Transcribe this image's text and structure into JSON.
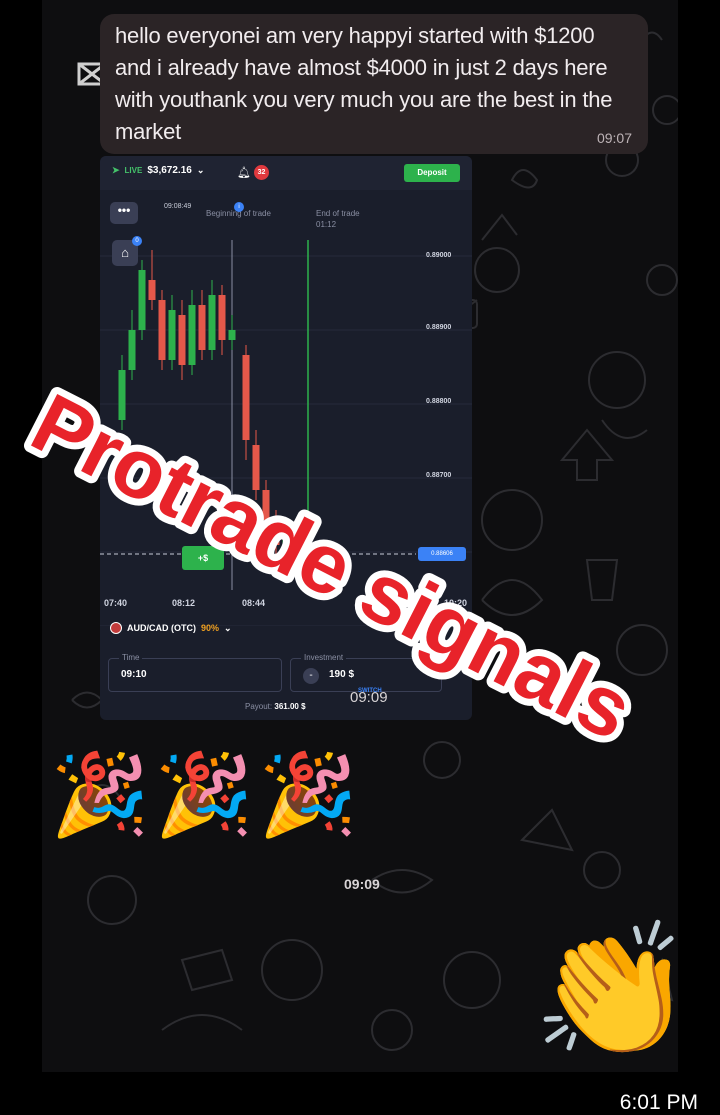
{
  "message": {
    "text": "hello everyonei am very happyi started with $1200 and i already have almost $4000 in just 2 days here with youthank you very much you are the best in the market",
    "time": "09:07"
  },
  "trading_screenshot": {
    "live_tag": "LIVE",
    "balance": "$3,672.16",
    "notifications": "32",
    "deposit_label": "Deposit",
    "menu_label": "•••",
    "home_badge": "0",
    "clock": "09:08:49",
    "beginning_label": "Beginning of trade",
    "end_label": "End of trade",
    "end_time": "01:12",
    "y_ticks": [
      "0.89000",
      "0.88900",
      "0.88800",
      "0.88700"
    ],
    "current_price": "0.88606",
    "x_ticks": [
      "07:40",
      "08:12",
      "08:44",
      "10:20"
    ],
    "trade_chip": "+$",
    "pair": "AUD/CAD (OTC)",
    "pair_percent": "90%",
    "time_label": "Time",
    "time_value": "09:10",
    "investment_label": "Investment",
    "investment_value": "190 $",
    "switch_label": "SWITCH",
    "payout_label": "Payout:",
    "payout_value": "361.00 $"
  },
  "screenshot_time": "09:09",
  "emoji_time": "09:09",
  "party_emoji": "🎉",
  "clap_emoji": "👏",
  "watermark_text": "Protrade signals",
  "status_bar": {
    "time": "6:01 PM"
  },
  "colors": {
    "bubble": "#2b2426",
    "watermark_fill": "#e8232a",
    "watermark_outline": "#ffffff",
    "bull": "#2db24c",
    "bear": "#e5584a"
  }
}
